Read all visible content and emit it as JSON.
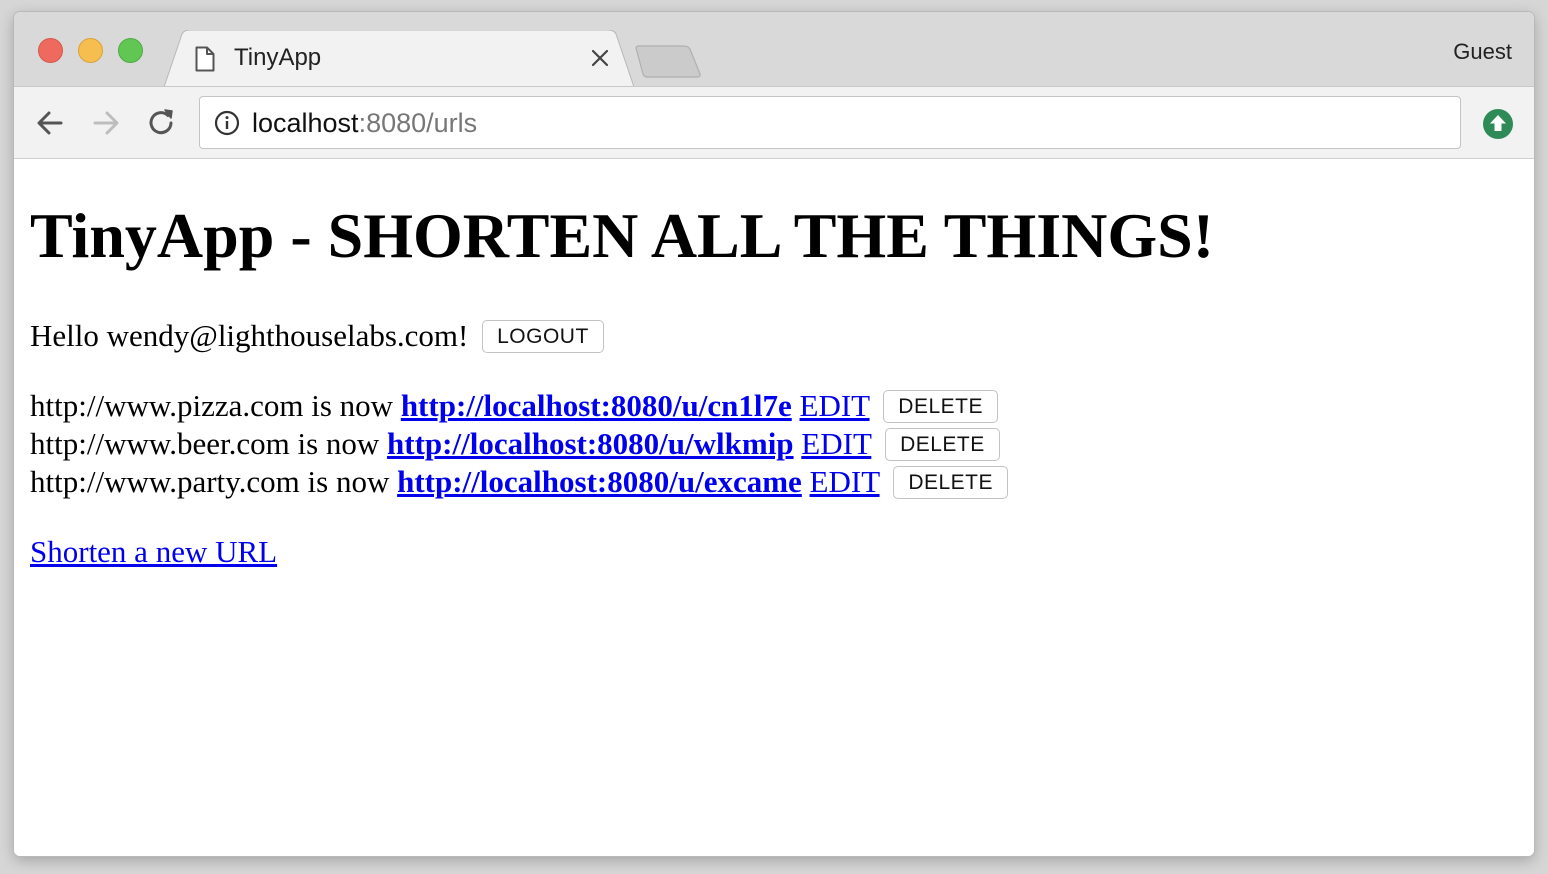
{
  "browser": {
    "tab_title": "TinyApp",
    "profile_label": "Guest",
    "url_host": "localhost",
    "url_rest": ":8080/urls"
  },
  "page": {
    "heading": "TinyApp - SHORTEN ALL THE THINGS!",
    "greeting": "Hello wendy@lighthouselabs.com!",
    "logout_label": "LOGOUT",
    "urls": [
      {
        "long_url": "http://www.pizza.com",
        "is_now": "is now",
        "short_url": "http://localhost:8080/u/cn1l7e",
        "edit_label": "EDIT",
        "delete_label": "DELETE"
      },
      {
        "long_url": "http://www.beer.com",
        "is_now": "is now",
        "short_url": "http://localhost:8080/u/wlkmip",
        "edit_label": "EDIT",
        "delete_label": "DELETE"
      },
      {
        "long_url": "http://www.party.com",
        "is_now": "is now",
        "short_url": "http://localhost:8080/u/excame",
        "edit_label": "EDIT",
        "delete_label": "DELETE"
      }
    ],
    "new_url_link": "Shorten a new URL"
  },
  "icons": {
    "tab_page": "document-icon",
    "tab_close": "close-icon",
    "back": "arrow-left-icon",
    "forward": "arrow-right-icon",
    "reload": "reload-icon",
    "site_info": "info-icon",
    "update": "update-arrow-icon"
  },
  "colors": {
    "link": "#0000ee",
    "traffic_close": "#ee6a5e",
    "traffic_minimize": "#f6be4f",
    "traffic_maximize": "#62c655",
    "update_badge": "#2e8b57"
  }
}
